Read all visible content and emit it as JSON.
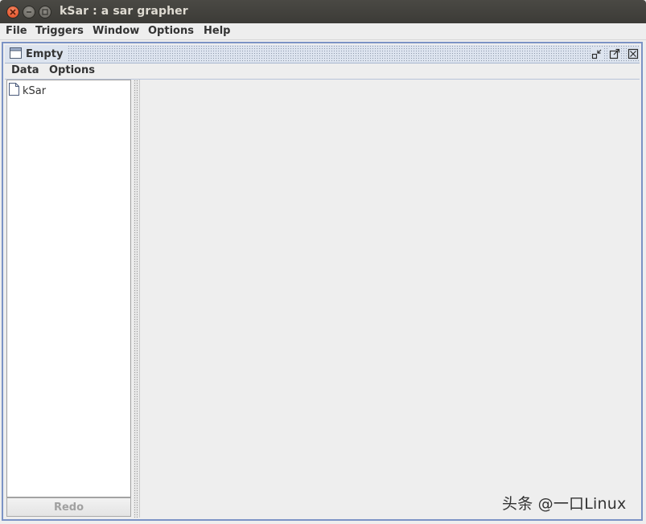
{
  "window": {
    "title": "kSar : a sar grapher",
    "controls": {
      "close_icon": "close-icon",
      "minimize_icon": "minimize-icon",
      "maximize_icon": "maximize-icon"
    }
  },
  "menubar": {
    "items": [
      "File",
      "Triggers",
      "Window",
      "Options",
      "Help"
    ]
  },
  "internal_frame": {
    "title": "Empty",
    "icons": [
      "window-icon",
      "iconify-icon",
      "maximize-icon",
      "close-icon"
    ],
    "menu": {
      "items": [
        "Data",
        "Options"
      ]
    },
    "tree": {
      "root_label": "kSar"
    },
    "redo_label": "Redo"
  },
  "watermark": "头条 @一口Linux",
  "colors": {
    "titlebar": "#3c3b37",
    "frame_border": "#7b93c5",
    "close_button": "#e0461c",
    "disabled_text": "#a0a0a0"
  }
}
